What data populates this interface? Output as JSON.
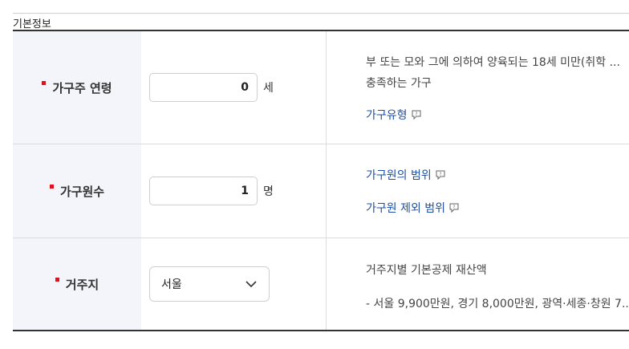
{
  "section": {
    "title": "기본정보"
  },
  "rows": [
    {
      "label": "가구주 연령",
      "input_value": "0",
      "unit": "세",
      "desc_line1": "부 또는 모와 그에 의하여 양육되는 18세 미만(취학 ...",
      "desc_line2": "충족하는 가구",
      "link1": "가구유형"
    },
    {
      "label": "가구원수",
      "input_value": "1",
      "unit": "명",
      "link1": "가구원의 범위",
      "link2": "가구원 제외 범위"
    },
    {
      "label": "거주지",
      "select_value": "서울",
      "desc_line1": "거주지별 기본공제 재산액",
      "desc_line2": "- 서울 9,900만원, 경기 8,000만원, 광역·세종·창원 7..."
    }
  ],
  "colors": {
    "required_marker": "#e0101f",
    "link": "#1f4f9e",
    "header_bg": "#f4f5fa"
  },
  "icons": {
    "help": "question-bubble-icon",
    "dropdown": "chevron-down-icon"
  }
}
